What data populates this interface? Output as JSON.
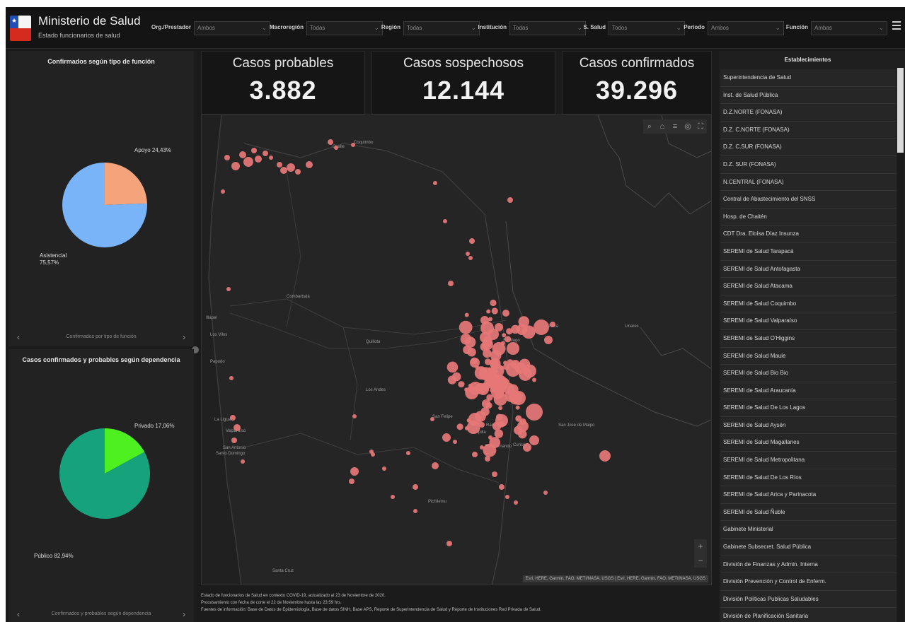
{
  "header": {
    "title": "Ministerio de Salud",
    "subtitle": "Estado funcionarios de salud",
    "menu_icon": "hamburger-icon"
  },
  "filters": [
    {
      "label": "Org./Prestador",
      "value": "Ambos"
    },
    {
      "label": "Macroregión",
      "value": "Todas"
    },
    {
      "label": "Región",
      "value": "Todas"
    },
    {
      "label": "Institución",
      "value": "Todas"
    },
    {
      "label": "S. Salud",
      "value": "Todos"
    },
    {
      "label": "Período",
      "value": "Ambos"
    },
    {
      "label": "Función",
      "value": "Ambas"
    }
  ],
  "kpis": [
    {
      "label": "Casos probables",
      "value": "3.882"
    },
    {
      "label": "Casos sospechosos",
      "value": "12.144"
    },
    {
      "label": "Casos confirmados",
      "value": "39.296"
    }
  ],
  "panel_funcion": {
    "title": "Confirmados según tipo de función",
    "footer": "Confirmados por tipo de función"
  },
  "panel_dependencia": {
    "title": "Casos confirmados y probables según dependencia",
    "footer": "Confirmados y probables según dependencia"
  },
  "chart_data": [
    {
      "type": "pie",
      "title": "Confirmados según tipo de función",
      "categories": [
        "Apoyo",
        "Asistencial"
      ],
      "values": [
        24.43,
        75.57
      ],
      "labels": [
        "Apoyo 24,43%",
        "Asistencial 75,57%"
      ],
      "colors": [
        "#f5a37a",
        "#78b4f7"
      ]
    },
    {
      "type": "pie",
      "title": "Casos confirmados y probables según dependencia",
      "categories": [
        "Privado",
        "Público"
      ],
      "values": [
        17.06,
        82.94
      ],
      "labels": [
        "Privado 17,06%",
        "Público 82,94%"
      ],
      "colors": [
        "#4ef01f",
        "#16a37c"
      ]
    }
  ],
  "map": {
    "tools": [
      "search-icon",
      "basemap-icon",
      "list-icon",
      "locate-icon",
      "fullscreen-icon"
    ],
    "zoom_in": "+",
    "zoom_out": "−",
    "attribution": "Esri, HERE, Garmin, FAO, METI/NASA, USGS | Esri, HERE, Garmin, FAO, METI/NASA, USGS",
    "place_labels": [
      "Ovalle",
      "Coquimbo",
      "Combarbalá",
      "Illapel",
      "Los Vilos",
      "Papudo",
      "La Ligua",
      "Quillota",
      "Los Andes",
      "San Felipe",
      "Valparaíso",
      "Santiago",
      "Rancagua",
      "San Antonio",
      "Melipilla",
      "San Fernando",
      "Talca",
      "Curicó",
      "Santo Domingo",
      "San José de Maipo",
      "Pichilemu",
      "Santa Cruz",
      "Linares"
    ]
  },
  "notes": [
    "Estado de funcionarios de Salud en contexto COVID-19, actualizado al 23 de Noviembre de 2020.",
    "Procesamiento con fecha de corte el 22 de Noviembre hasta las 23:59 hrs.",
    "Fuentes de información: Base de Datos de Epidemiología, Base de datos SINH, Base APS, Reporte de Superintendencia de Salud y Reporte de Instituciones Red Privada de Salud."
  ],
  "establecimientos": {
    "title": "Establecimientos",
    "items": [
      "Superintendencia de Salud",
      "Inst. de Salud Pública",
      "D.Z.NORTE (FONASA)",
      "D.Z. C.NORTE (FONASA)",
      "D.Z. C.SUR (FONASA)",
      "D.Z. SUR (FONASA)",
      "N.CENTRAL (FONASA)",
      "Central de Abastecimiento del SNSS",
      "Hosp. de Chaitén",
      "CDT Dra. Eloísa Díaz Insunza",
      "SEREMI de Salud Tarapacá",
      "SEREMI de Salud Antofagasta",
      "SEREMI de Salud Atacama",
      "SEREMI de Salud Coquimbo",
      "SEREMI de Salud Valparaíso",
      "SEREMI de Salud O'Higgins",
      "SEREMI de Salud Maule",
      "SEREMI de Salud Bio Bio",
      "SEREMI de Salud Araucanía",
      "SEREMI de Salud De Los Lagos",
      "SEREMI de Salud Aysén",
      "SEREMI de Salud Magallanes",
      "SEREMI de Salud Metropolitana",
      "SEREMI de Salud De Los Ríos",
      "SEREMI de Salud Arica y Parinacota",
      "SEREMI de Salud Ñuble",
      "Gabinete Ministerial",
      "Gabinete Subsecret. Salud Pública",
      "División de Finanzas y Admin. Interna",
      "División Prevención y Control de Enferm.",
      "División Políticas Publicas Saludables",
      "División de Planificación Sanitaria"
    ]
  }
}
